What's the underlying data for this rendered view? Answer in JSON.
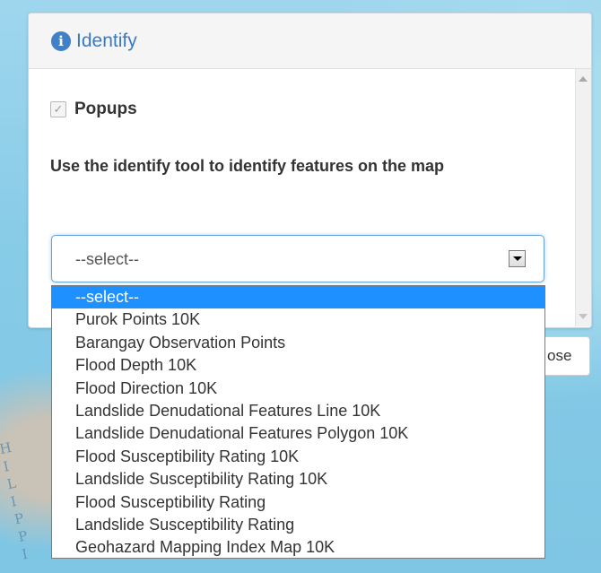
{
  "panel": {
    "title": "Identify",
    "info_icon": "i",
    "popups_checkbox": {
      "label": "Popups",
      "checked": true,
      "check_glyph": "✓"
    },
    "instructions": "Use the identify tool to identify features on the map"
  },
  "layer_select": {
    "value": "--select--",
    "options": [
      "--select--",
      "Purok Points 10K",
      "Barangay Observation Points",
      "Flood Depth 10K",
      "Flood Direction 10K",
      "Landslide Denudational Features Line 10K",
      "Landslide Denudational Features Polygon 10K",
      "Flood Susceptibility Rating 10K",
      "Landslide Susceptibility Rating 10K",
      "Flood Susceptibility Rating",
      "Landslide Susceptibility Rating",
      "Geohazard Mapping Index Map 10K"
    ],
    "highlighted_index": 0
  },
  "close_button": {
    "label": "ose"
  },
  "map": {
    "label": "HILIPPI"
  },
  "colors": {
    "accent": "#3b79c3",
    "highlight": "#1e90ff",
    "map_water": "#8fd0ea"
  }
}
